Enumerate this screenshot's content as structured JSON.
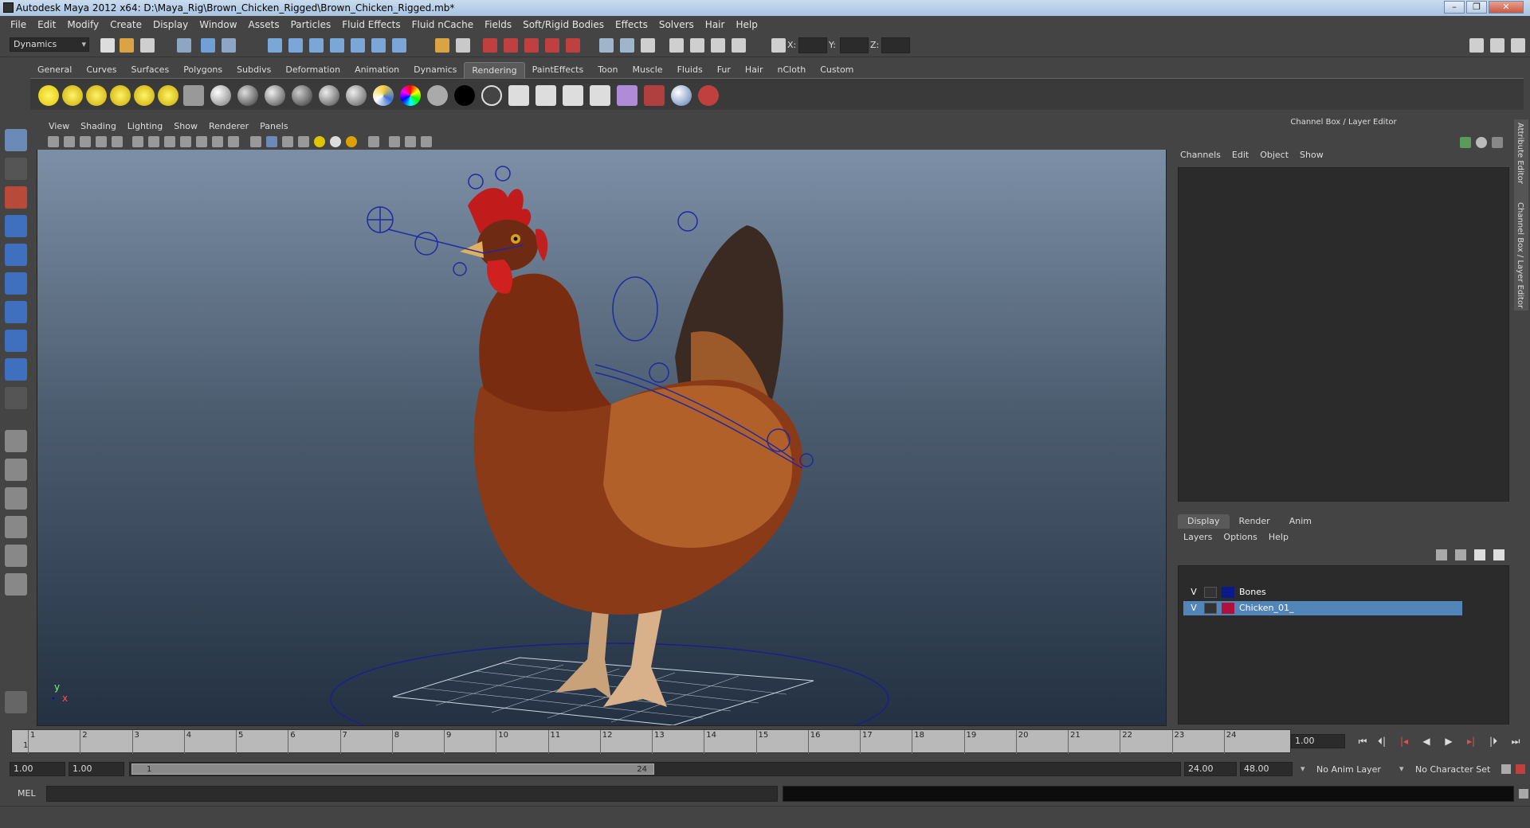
{
  "window": {
    "title": "Autodesk Maya 2012 x64: D:\\Maya_Rig\\Brown_Chicken_Rigged\\Brown_Chicken_Rigged.mb*"
  },
  "menubar": [
    "File",
    "Edit",
    "Modify",
    "Create",
    "Display",
    "Window",
    "Assets",
    "Particles",
    "Fluid Effects",
    "Fluid nCache",
    "Fields",
    "Soft/Rigid Bodies",
    "Effects",
    "Solvers",
    "Hair",
    "Help"
  ],
  "statusline": {
    "mode": "Dynamics",
    "x_label": "X:",
    "y_label": "Y:",
    "z_label": "Z:"
  },
  "shelf": {
    "tabs": [
      "General",
      "Curves",
      "Surfaces",
      "Polygons",
      "Subdivs",
      "Deformation",
      "Animation",
      "Dynamics",
      "Rendering",
      "PaintEffects",
      "Toon",
      "Muscle",
      "Fluids",
      "Fur",
      "Hair",
      "nCloth",
      "Custom"
    ],
    "active": "Rendering"
  },
  "viewport": {
    "menu": [
      "View",
      "Shading",
      "Lighting",
      "Show",
      "Renderer",
      "Panels"
    ],
    "axis_y": "y",
    "axis_x": "x"
  },
  "channelbox": {
    "header": "Channel Box / Layer Editor",
    "menu": [
      "Channels",
      "Edit",
      "Object",
      "Show"
    ]
  },
  "layer_editor": {
    "tabs": [
      "Display",
      "Render",
      "Anim"
    ],
    "active_tab": "Display",
    "menu": [
      "Layers",
      "Options",
      "Help"
    ],
    "layers": [
      {
        "visible": "V",
        "name": "Bones",
        "color": "#0a1a8c",
        "selected": false
      },
      {
        "visible": "V",
        "name": "Chicken_01_",
        "color": "#b0103a",
        "selected": true
      }
    ]
  },
  "side_tabs": [
    "Attribute Editor",
    "Channel Box / Layer Editor"
  ],
  "timeline": {
    "ticks": [
      "1",
      "2",
      "3",
      "4",
      "5",
      "6",
      "7",
      "8",
      "9",
      "10",
      "11",
      "12",
      "13",
      "14",
      "15",
      "16",
      "17",
      "18",
      "19",
      "20",
      "21",
      "22",
      "23",
      "24"
    ],
    "current_marker": "1",
    "current_frame": "1.00"
  },
  "range": {
    "start": "1.00",
    "playback_start": "1.00",
    "thumb_start": "1",
    "thumb_end": "24",
    "playback_end": "24.00",
    "end": "48.00",
    "anim_layer": "No Anim Layer",
    "character_set": "No Character Set"
  },
  "command": {
    "label": "MEL"
  }
}
